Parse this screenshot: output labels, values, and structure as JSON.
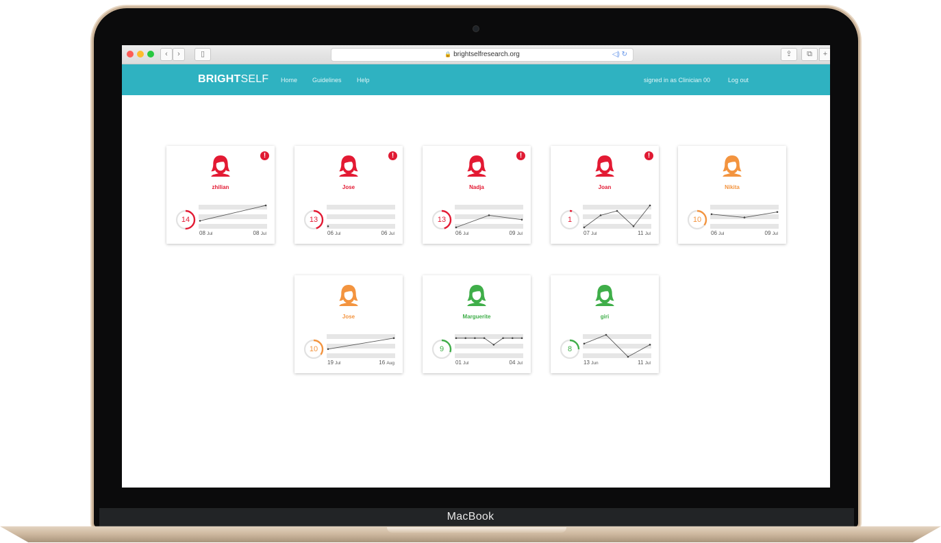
{
  "device": {
    "brand": "MacBook"
  },
  "browser": {
    "url": "brightselfresearch.org"
  },
  "app": {
    "logo_bold": "BRIGHT",
    "logo_light": "SELF",
    "nav": [
      "Home",
      "Guidelines",
      "Help"
    ],
    "signed_in": "signed in as Clinician 00",
    "logout": "Log out"
  },
  "colors": {
    "red": "#e31a33",
    "orange": "#f3943f",
    "green": "#3fae49",
    "teal": "#2fb2c1"
  },
  "patients": [
    {
      "name": "zhilian",
      "score": "14",
      "status": "red",
      "alert": true,
      "progress": 0.5,
      "start_day": "08",
      "start_mon": "Jul",
      "end_day": "08",
      "end_mon": "Jul",
      "trend": [
        0.3,
        1.0
      ]
    },
    {
      "name": "Jose",
      "score": "13",
      "status": "red",
      "alert": true,
      "progress": 0.45,
      "start_day": "06",
      "start_mon": "Jul",
      "end_day": "06",
      "end_mon": "Jul",
      "trend": [
        0.05
      ]
    },
    {
      "name": "Nadja",
      "score": "13",
      "status": "red",
      "alert": true,
      "progress": 0.45,
      "start_day": "06",
      "start_mon": "Jul",
      "end_day": "09",
      "end_mon": "Jul",
      "trend": [
        0.0,
        0.55,
        0.35
      ]
    },
    {
      "name": "Joan",
      "score": "1",
      "status": "red",
      "alert": true,
      "progress": 0.04,
      "start_day": "07",
      "start_mon": "Jul",
      "end_day": "11",
      "end_mon": "Jul",
      "trend": [
        0.0,
        0.55,
        0.75,
        0.05,
        1.0
      ]
    },
    {
      "name": "Nikita",
      "score": "10",
      "status": "orange",
      "alert": false,
      "progress": 0.35,
      "start_day": "06",
      "start_mon": "Jul",
      "end_day": "09",
      "end_mon": "Jul",
      "trend": [
        0.6,
        0.45,
        0.7
      ]
    },
    {
      "name": "Jose",
      "score": "10",
      "status": "orange",
      "alert": false,
      "progress": 0.35,
      "start_day": "19",
      "start_mon": "Jul",
      "end_day": "16",
      "end_mon": "Aug",
      "trend": [
        0.35,
        0.85
      ]
    },
    {
      "name": "Marguerite",
      "score": "9",
      "status": "green",
      "alert": false,
      "progress": 0.3,
      "start_day": "01",
      "start_mon": "Jul",
      "end_day": "04",
      "end_mon": "Jul",
      "trend": [
        0.85,
        0.85,
        0.85,
        0.85,
        0.55,
        0.85,
        0.85,
        0.85
      ]
    },
    {
      "name": "giri",
      "score": "8",
      "status": "green",
      "alert": false,
      "progress": 0.25,
      "start_day": "13",
      "start_mon": "Jun",
      "end_day": "11",
      "end_mon": "Jul",
      "trend": [
        0.6,
        1.0,
        0.0,
        0.55
      ]
    }
  ]
}
